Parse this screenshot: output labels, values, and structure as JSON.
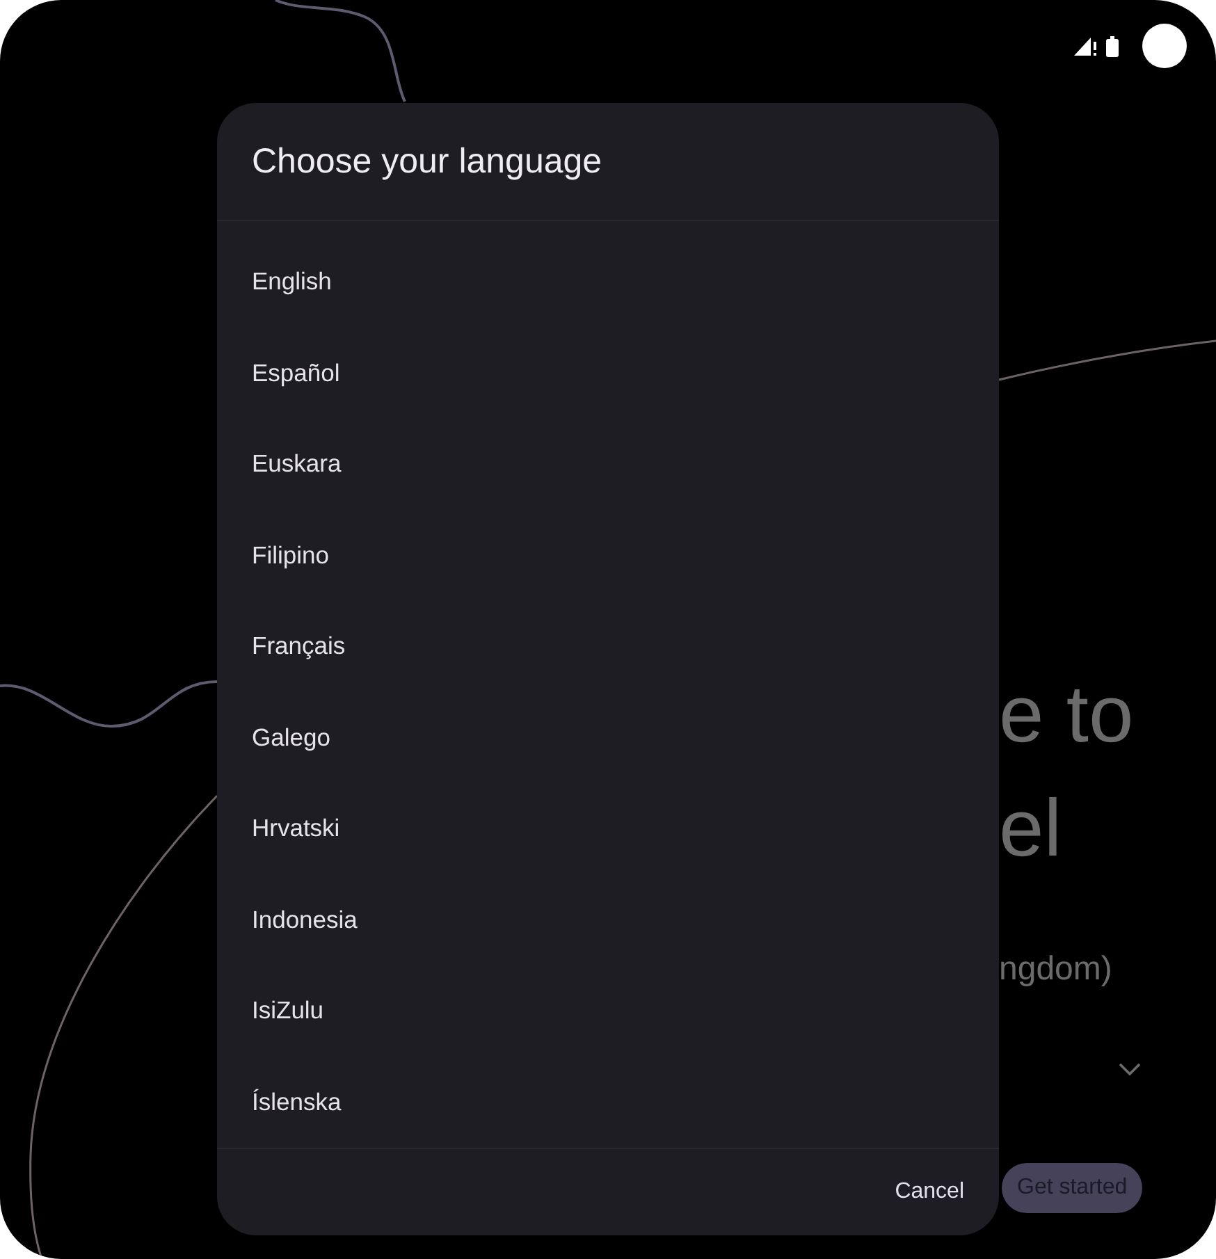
{
  "background": {
    "heading_lines": [
      "e to",
      "el"
    ],
    "subtitle": "ngdom)",
    "get_started_button": "Get started"
  },
  "dialog": {
    "title": "Choose your language",
    "languages": [
      "English",
      "Español",
      "Euskara",
      "Filipino",
      "Français",
      "Galego",
      "Hrvatski",
      "Indonesia",
      "IsiZulu",
      "Íslenska"
    ],
    "cancel_button": "Cancel"
  }
}
